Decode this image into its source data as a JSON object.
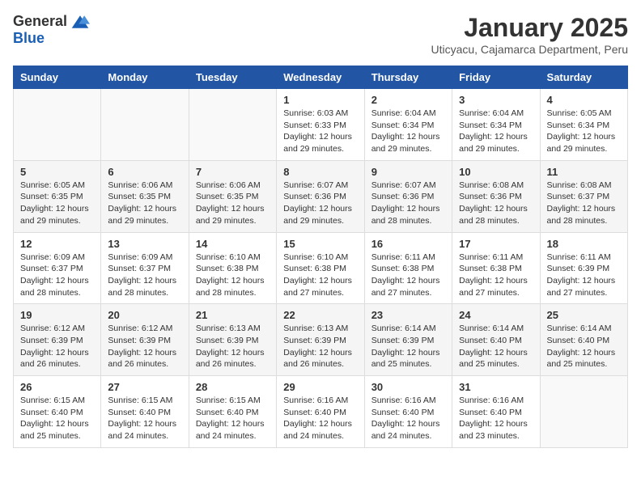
{
  "header": {
    "logo_general": "General",
    "logo_blue": "Blue",
    "month_title": "January 2025",
    "location": "Uticyacu, Cajamarca Department, Peru"
  },
  "weekdays": [
    "Sunday",
    "Monday",
    "Tuesday",
    "Wednesday",
    "Thursday",
    "Friday",
    "Saturday"
  ],
  "weeks": [
    [
      {
        "day": "",
        "info": ""
      },
      {
        "day": "",
        "info": ""
      },
      {
        "day": "",
        "info": ""
      },
      {
        "day": "1",
        "info": "Sunrise: 6:03 AM\nSunset: 6:33 PM\nDaylight: 12 hours\nand 29 minutes."
      },
      {
        "day": "2",
        "info": "Sunrise: 6:04 AM\nSunset: 6:34 PM\nDaylight: 12 hours\nand 29 minutes."
      },
      {
        "day": "3",
        "info": "Sunrise: 6:04 AM\nSunset: 6:34 PM\nDaylight: 12 hours\nand 29 minutes."
      },
      {
        "day": "4",
        "info": "Sunrise: 6:05 AM\nSunset: 6:34 PM\nDaylight: 12 hours\nand 29 minutes."
      }
    ],
    [
      {
        "day": "5",
        "info": "Sunrise: 6:05 AM\nSunset: 6:35 PM\nDaylight: 12 hours\nand 29 minutes."
      },
      {
        "day": "6",
        "info": "Sunrise: 6:06 AM\nSunset: 6:35 PM\nDaylight: 12 hours\nand 29 minutes."
      },
      {
        "day": "7",
        "info": "Sunrise: 6:06 AM\nSunset: 6:35 PM\nDaylight: 12 hours\nand 29 minutes."
      },
      {
        "day": "8",
        "info": "Sunrise: 6:07 AM\nSunset: 6:36 PM\nDaylight: 12 hours\nand 29 minutes."
      },
      {
        "day": "9",
        "info": "Sunrise: 6:07 AM\nSunset: 6:36 PM\nDaylight: 12 hours\nand 28 minutes."
      },
      {
        "day": "10",
        "info": "Sunrise: 6:08 AM\nSunset: 6:36 PM\nDaylight: 12 hours\nand 28 minutes."
      },
      {
        "day": "11",
        "info": "Sunrise: 6:08 AM\nSunset: 6:37 PM\nDaylight: 12 hours\nand 28 minutes."
      }
    ],
    [
      {
        "day": "12",
        "info": "Sunrise: 6:09 AM\nSunset: 6:37 PM\nDaylight: 12 hours\nand 28 minutes."
      },
      {
        "day": "13",
        "info": "Sunrise: 6:09 AM\nSunset: 6:37 PM\nDaylight: 12 hours\nand 28 minutes."
      },
      {
        "day": "14",
        "info": "Sunrise: 6:10 AM\nSunset: 6:38 PM\nDaylight: 12 hours\nand 28 minutes."
      },
      {
        "day": "15",
        "info": "Sunrise: 6:10 AM\nSunset: 6:38 PM\nDaylight: 12 hours\nand 27 minutes."
      },
      {
        "day": "16",
        "info": "Sunrise: 6:11 AM\nSunset: 6:38 PM\nDaylight: 12 hours\nand 27 minutes."
      },
      {
        "day": "17",
        "info": "Sunrise: 6:11 AM\nSunset: 6:38 PM\nDaylight: 12 hours\nand 27 minutes."
      },
      {
        "day": "18",
        "info": "Sunrise: 6:11 AM\nSunset: 6:39 PM\nDaylight: 12 hours\nand 27 minutes."
      }
    ],
    [
      {
        "day": "19",
        "info": "Sunrise: 6:12 AM\nSunset: 6:39 PM\nDaylight: 12 hours\nand 26 minutes."
      },
      {
        "day": "20",
        "info": "Sunrise: 6:12 AM\nSunset: 6:39 PM\nDaylight: 12 hours\nand 26 minutes."
      },
      {
        "day": "21",
        "info": "Sunrise: 6:13 AM\nSunset: 6:39 PM\nDaylight: 12 hours\nand 26 minutes."
      },
      {
        "day": "22",
        "info": "Sunrise: 6:13 AM\nSunset: 6:39 PM\nDaylight: 12 hours\nand 26 minutes."
      },
      {
        "day": "23",
        "info": "Sunrise: 6:14 AM\nSunset: 6:39 PM\nDaylight: 12 hours\nand 25 minutes."
      },
      {
        "day": "24",
        "info": "Sunrise: 6:14 AM\nSunset: 6:40 PM\nDaylight: 12 hours\nand 25 minutes."
      },
      {
        "day": "25",
        "info": "Sunrise: 6:14 AM\nSunset: 6:40 PM\nDaylight: 12 hours\nand 25 minutes."
      }
    ],
    [
      {
        "day": "26",
        "info": "Sunrise: 6:15 AM\nSunset: 6:40 PM\nDaylight: 12 hours\nand 25 minutes."
      },
      {
        "day": "27",
        "info": "Sunrise: 6:15 AM\nSunset: 6:40 PM\nDaylight: 12 hours\nand 24 minutes."
      },
      {
        "day": "28",
        "info": "Sunrise: 6:15 AM\nSunset: 6:40 PM\nDaylight: 12 hours\nand 24 minutes."
      },
      {
        "day": "29",
        "info": "Sunrise: 6:16 AM\nSunset: 6:40 PM\nDaylight: 12 hours\nand 24 minutes."
      },
      {
        "day": "30",
        "info": "Sunrise: 6:16 AM\nSunset: 6:40 PM\nDaylight: 12 hours\nand 24 minutes."
      },
      {
        "day": "31",
        "info": "Sunrise: 6:16 AM\nSunset: 6:40 PM\nDaylight: 12 hours\nand 23 minutes."
      },
      {
        "day": "",
        "info": ""
      }
    ]
  ]
}
